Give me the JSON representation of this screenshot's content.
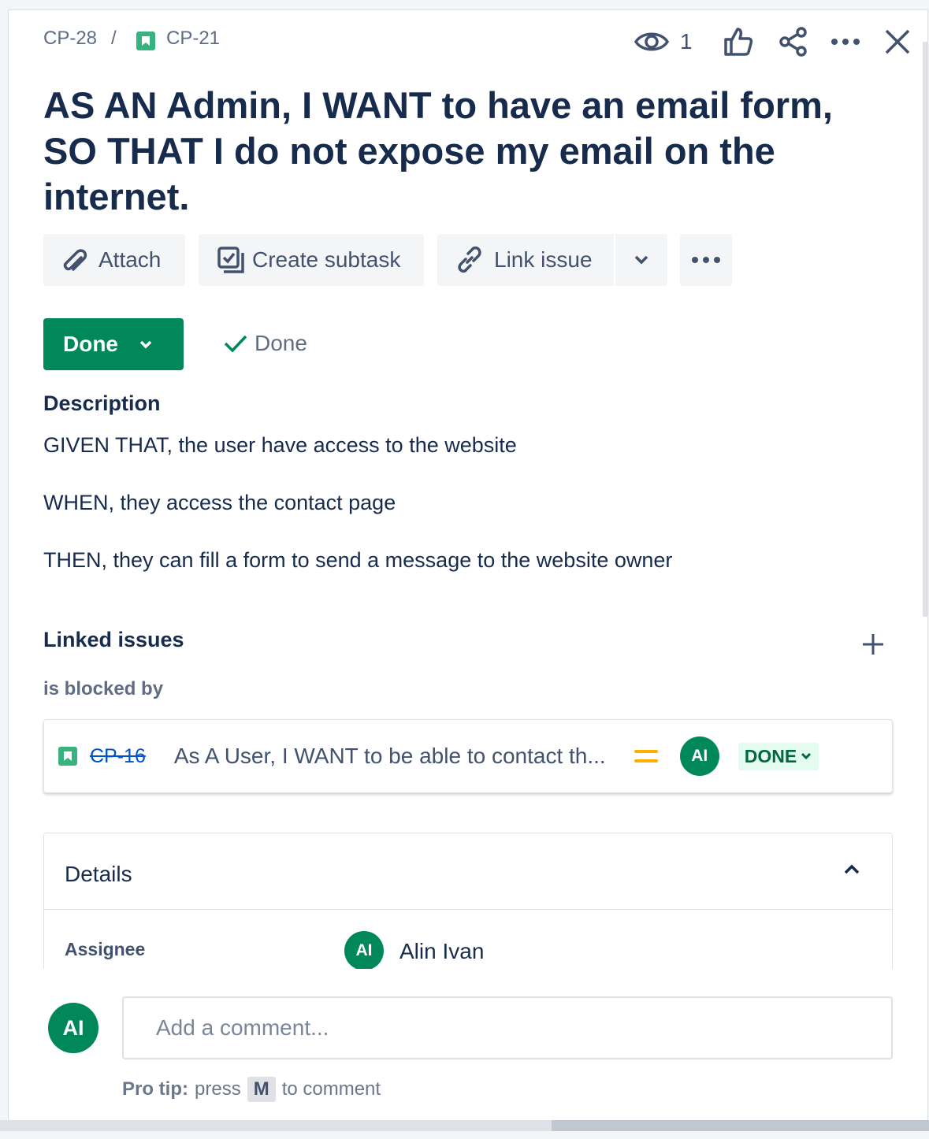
{
  "breadcrumb": {
    "parent": "CP-28",
    "separator": "/",
    "current": "CP-21"
  },
  "header": {
    "watch_count": "1"
  },
  "issue": {
    "title": "AS AN Admin, I WANT to have an email form, SO THAT I do not expose my email on the internet."
  },
  "toolbar": {
    "attach": "Attach",
    "create_subtask": "Create subtask",
    "link_issue": "Link issue"
  },
  "status": {
    "label": "Done",
    "resolution": "Done"
  },
  "description": {
    "heading": "Description",
    "lines": [
      "GIVEN THAT,  the user have access to the website",
      "WHEN, they access the contact page",
      "THEN, they can fill a form to send a message to the website owner"
    ]
  },
  "linked_issues": {
    "heading": "Linked issues",
    "relation": "is blocked by",
    "items": [
      {
        "key": "CP-16",
        "summary": "As A User, I WANT to be able to contact th...",
        "assignee_initials": "AI",
        "status": "DONE"
      }
    ]
  },
  "details": {
    "heading": "Details",
    "assignee_label": "Assignee",
    "assignee_initials": "AI",
    "assignee_name": "Alin Ivan"
  },
  "comment": {
    "avatar_initials": "AI",
    "placeholder": "Add a comment...",
    "tip_label": "Pro tip:",
    "tip_press": "press",
    "tip_key": "M",
    "tip_suffix": "to comment"
  },
  "colors": {
    "done_green": "#00875a",
    "story_green": "#36b37e",
    "priority_medium": "#ffab00",
    "link_blue": "#0052cc"
  }
}
